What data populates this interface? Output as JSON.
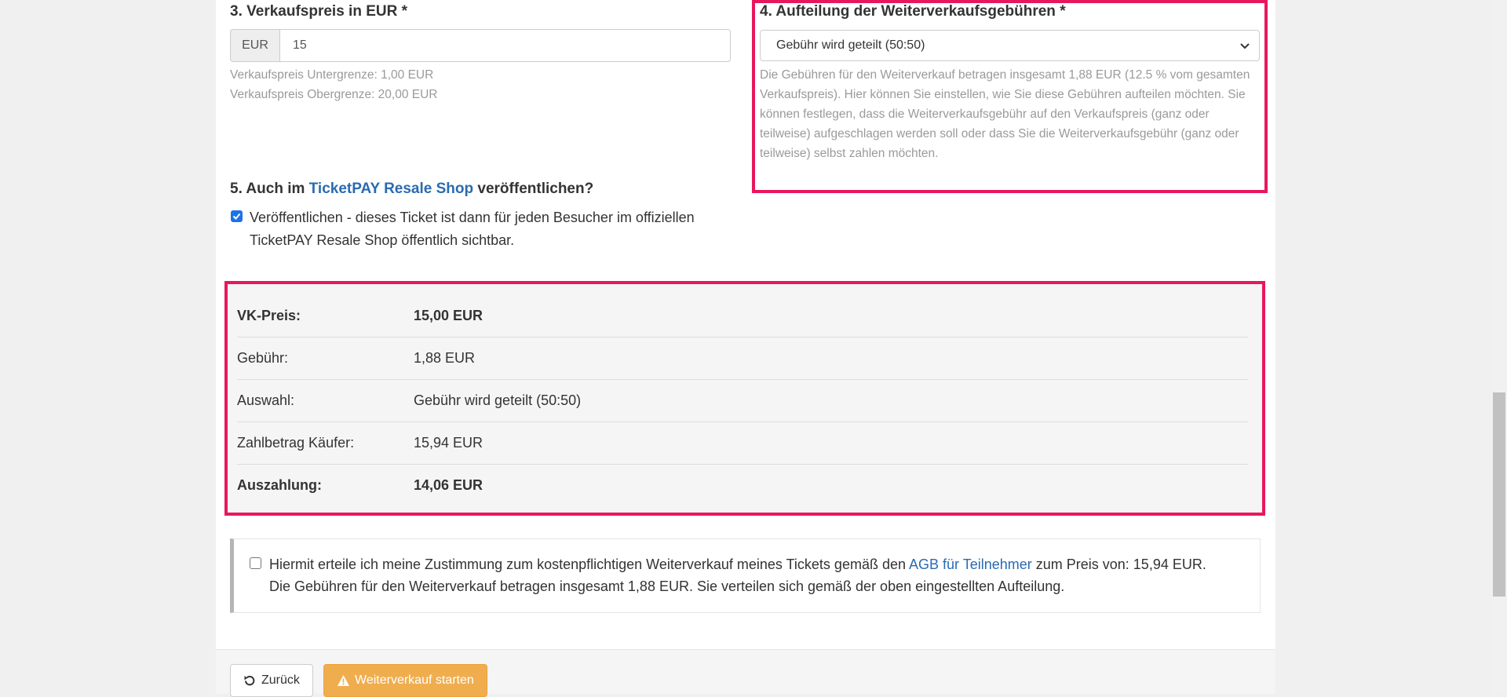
{
  "price_section": {
    "heading": "3. Verkaufspreis in EUR *",
    "currency_addon": "EUR",
    "price_value": "15",
    "min_hint": "Verkaufspreis Untergrenze: 1,00 EUR",
    "max_hint": "Verkaufspreis Obergrenze: 20,00 EUR"
  },
  "fee_section": {
    "heading": "4. Aufteilung der Weiterverkaufsgebühren *",
    "selected_option": "Gebühr wird geteilt (50:50)",
    "help_lines": [
      "Die Gebühren für den Weiterverkauf betragen insgesamt 1,88 EUR (12.5 % vom gesamten",
      "Verkaufspreis). Hier können Sie einstellen, wie Sie diese Gebühren aufteilen möchten. Sie",
      "können festlegen, dass die Weiterverkaufsgebühr auf den Verkaufspreis (ganz oder",
      "teilweise) aufgeschlagen werden soll oder dass Sie die Weiterverkaufsgebühr (ganz oder",
      "teilweise) selbst zahlen möchten."
    ]
  },
  "publish_section": {
    "heading_prefix": "5. Auch im ",
    "heading_link": "TicketPAY Resale Shop",
    "heading_suffix": " veröffentlichen?",
    "checkbox_checked": true,
    "checkbox_line1": "Veröffentlichen - dieses Ticket ist dann für jeden Besucher im offiziellen",
    "checkbox_line2": "TicketPAY Resale Shop öffentlich sichtbar."
  },
  "summary": {
    "rows": [
      {
        "label": "VK-Preis:",
        "value": "15,00 EUR",
        "bold": true
      },
      {
        "label": "Gebühr:",
        "value": "1,88 EUR",
        "bold": false
      },
      {
        "label": "Auswahl:",
        "value": "Gebühr wird geteilt (50:50)",
        "bold": false
      },
      {
        "label": "Zahlbetrag Käufer:",
        "value": "15,94 EUR",
        "bold": false
      },
      {
        "label": "Auszahlung:",
        "value": "14,06 EUR",
        "bold": true
      }
    ]
  },
  "consent": {
    "checked": false,
    "line1_prefix": "Hiermit erteile ich meine Zustimmung zum kostenpflichtigen Weiterverkauf meines Tickets gemäß den ",
    "line1_link": "AGB für Teilnehmer",
    "line1_suffix": " zum Preis von: 15,94 EUR.",
    "line2": "Die Gebühren für den Weiterverkauf betragen insgesamt 1,88 EUR. Sie verteilen sich gemäß der oben eingestellten Aufteilung."
  },
  "footer": {
    "back_label": "Zurück",
    "start_label": "Weiterverkauf starten"
  },
  "colors": {
    "highlight_frame": "#e8175d",
    "link": "#2a6bb0",
    "warning_button": "#f0ad4e"
  },
  "icons": [
    "chevron-down-icon",
    "checkmark-icon",
    "undo-icon",
    "warning-icon"
  ]
}
